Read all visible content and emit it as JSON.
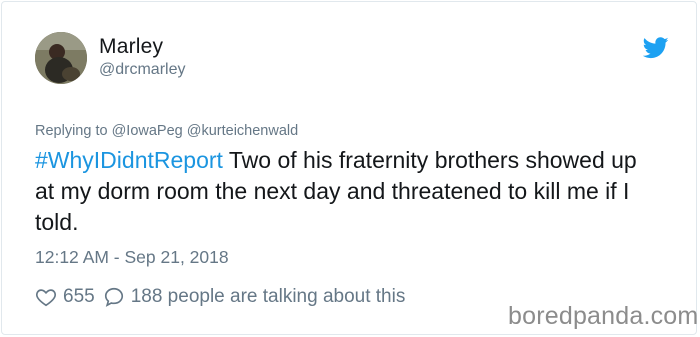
{
  "author": {
    "name": "Marley",
    "handle": "@drcmarley"
  },
  "icons": {
    "brand": "twitter-bird-icon",
    "like": "heart-icon",
    "comment": "speech-bubble-icon"
  },
  "colors": {
    "hashtag": "#1b95e0",
    "twitter_blue": "#1da1f2",
    "muted": "#657786",
    "text": "#14171a"
  },
  "reply": {
    "text": "Replying to @IowaPeg @kurteichenwald"
  },
  "tweet": {
    "hashtag": "#WhyIDidntReport",
    "body": " Two of his fraternity brothers showed up at my dorm room the next day and threatened to kill me if I told."
  },
  "timestamp": "12:12 AM - Sep 21, 2018",
  "engagement": {
    "likes": "655",
    "talking": "188 people are talking about this"
  },
  "watermark": "boredpanda.com"
}
